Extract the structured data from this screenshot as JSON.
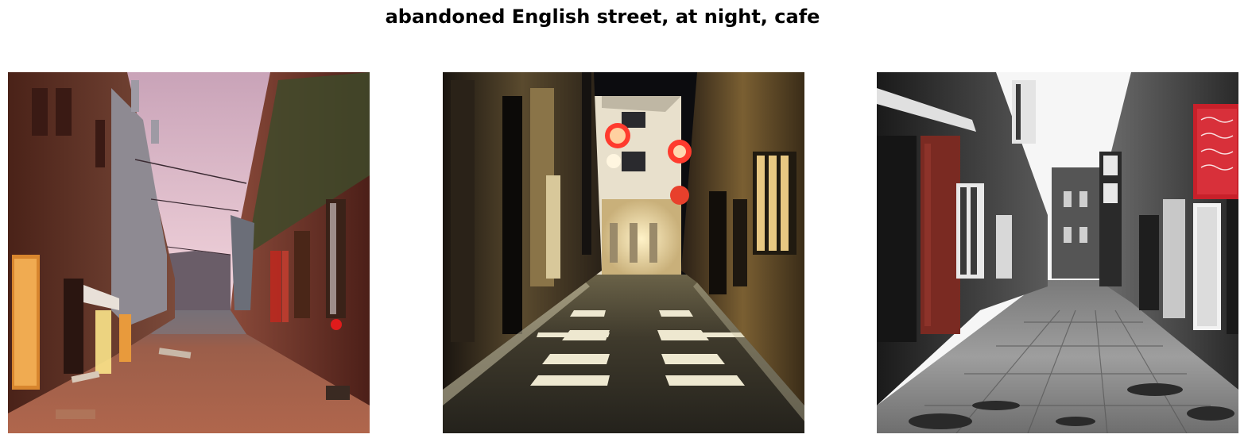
{
  "figure": {
    "title": "abandoned English street, at night, cafe"
  },
  "panels": [
    {
      "subject": "street-dusk",
      "palette": {
        "sky": "#e9c6d4",
        "brick": "#7a3a2c",
        "ground": "#a45a42",
        "glow": "#ffb347",
        "accent": "#e01b1b"
      }
    },
    {
      "subject": "alley-night",
      "palette": {
        "sky": "#0d0d10",
        "wall": "#3a2f1e",
        "ground": "#3b3526",
        "glow": "#f5dc9c",
        "accent": "#ff3b2e"
      }
    },
    {
      "subject": "street-bw",
      "palette": {
        "sky": "#f4f4f4",
        "wall": "#4a4a4a",
        "ground": "#9a9a9a",
        "brick": "#7a2a22",
        "accent": "#c8202a"
      }
    }
  ]
}
